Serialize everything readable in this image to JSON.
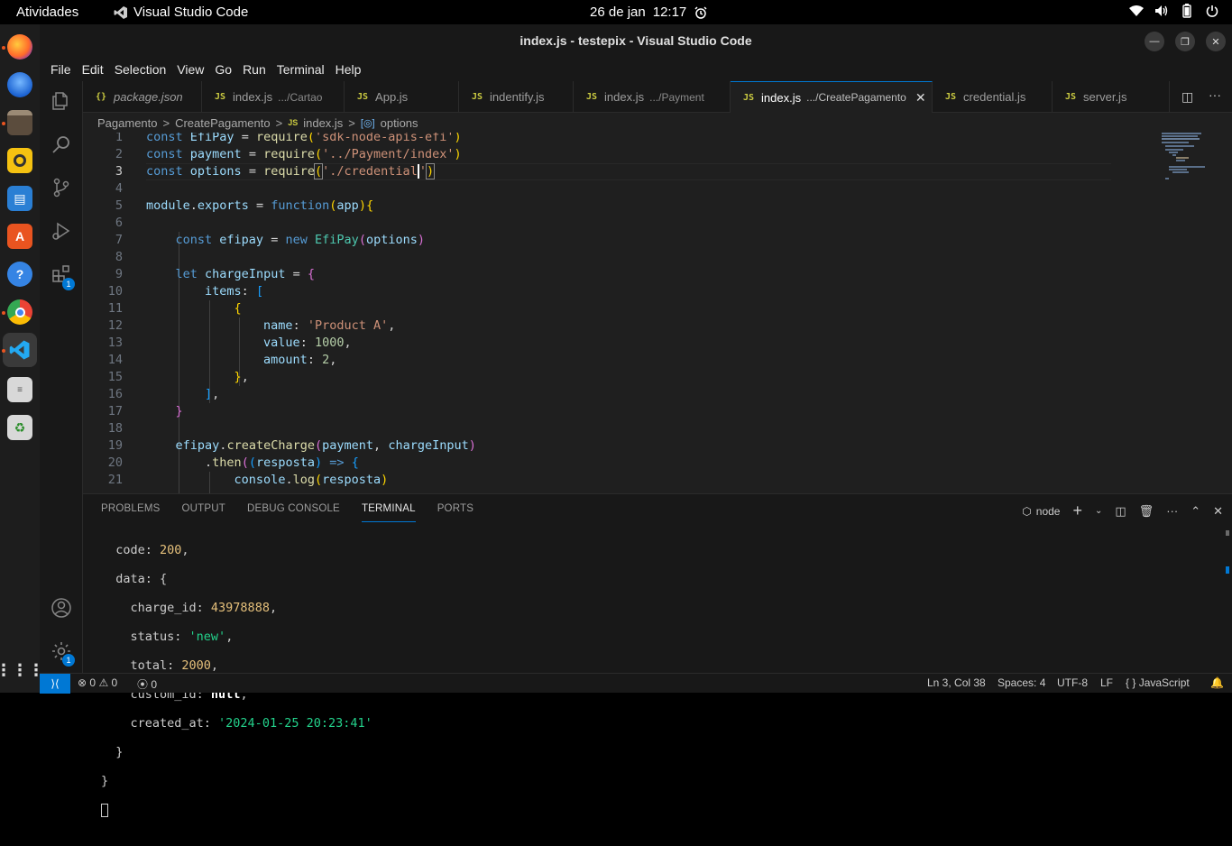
{
  "topbar": {
    "activities": "Atividades",
    "app_name": "Visual Studio Code",
    "date": "26 de jan",
    "time": "12:17"
  },
  "dock": {
    "items": [
      "firefox-icon",
      "thunderbird-icon",
      "files-icon",
      "rhythmbox-icon",
      "writer-icon",
      "software-icon",
      "help-icon",
      "chrome-icon",
      "vscode-icon",
      "text-editor-icon",
      "trash-icon",
      "apps-grid-icon"
    ]
  },
  "window": {
    "title": "index.js - testepix - Visual Studio Code"
  },
  "menu": [
    "File",
    "Edit",
    "Selection",
    "View",
    "Go",
    "Run",
    "Terminal",
    "Help"
  ],
  "activity": {
    "extensions_badge": "1",
    "settings_badge": "1"
  },
  "tabs": [
    {
      "icon": "{}",
      "name": "package.json",
      "path": ""
    },
    {
      "icon": "JS",
      "name": "index.js",
      "path": ".../Cartao"
    },
    {
      "icon": "JS",
      "name": "App.js",
      "path": ""
    },
    {
      "icon": "JS",
      "name": "indentify.js",
      "path": ""
    },
    {
      "icon": "JS",
      "name": "index.js",
      "path": ".../Payment"
    },
    {
      "icon": "JS",
      "name": "index.js",
      "path": ".../CreatePagamento"
    },
    {
      "icon": "JS",
      "name": "credential.js",
      "path": ""
    },
    {
      "icon": "JS",
      "name": "server.js",
      "path": ""
    }
  ],
  "breadcrumb": {
    "a": "Pagamento",
    "b": "CreatePagamento",
    "c": "index.js",
    "d": "options",
    "sep": ">"
  },
  "editor": {
    "line_numbers": [
      "1",
      "2",
      "3",
      "4",
      "5",
      "6",
      "7",
      "8",
      "9",
      "10",
      "11",
      "12",
      "13",
      "14",
      "15",
      "16",
      "17",
      "18",
      "19",
      "20",
      "21"
    ]
  },
  "panel": {
    "tabs": [
      "PROBLEMS",
      "OUTPUT",
      "DEBUG CONSOLE",
      "TERMINAL",
      "PORTS"
    ],
    "shell": "node"
  },
  "status": {
    "errors": "0",
    "warnings": "0",
    "ports": "0",
    "position": "Ln 3, Col 38",
    "spaces": "Spaces: 4",
    "encoding": "UTF-8",
    "eol": "LF",
    "language": "JavaScript",
    "language_prefix": "{ }"
  }
}
